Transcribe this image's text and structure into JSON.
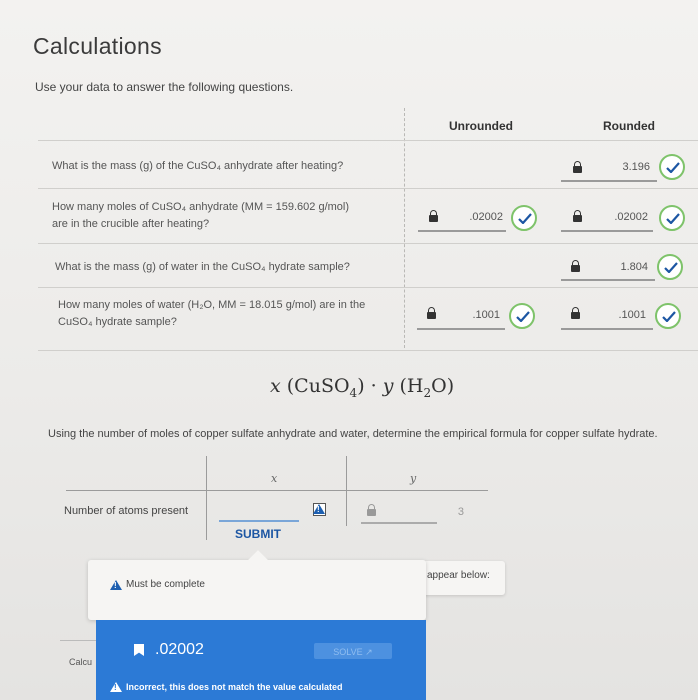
{
  "page": {
    "title": "Calculations",
    "subtitle": "Use your data to answer the following questions."
  },
  "table": {
    "headers": {
      "unrounded": "Unrounded",
      "rounded": "Rounded"
    },
    "rows": [
      {
        "question": "What is the mass (g) of the CuSO₄ anhydrate after heating?",
        "unrounded": "",
        "rounded": "3.196",
        "status": "correct"
      },
      {
        "question_line1": "How many moles of CuSO₄ anhydrate (MM = 159.602 g/mol)",
        "question_line2": "are in the crucible after heating?",
        "unrounded": ".02002",
        "rounded": ".02002",
        "status": "correct"
      },
      {
        "question": "What is the mass (g) of water in the CuSO₄ hydrate sample?",
        "unrounded": "",
        "rounded": "1.804",
        "status": "correct"
      },
      {
        "question_line1": "How many moles of water (H₂O, MM = 18.015 g/mol) are in the",
        "question_line2": "CuSO₄ hydrate sample?",
        "unrounded": ".1001",
        "rounded": ".1001",
        "status": "correct"
      }
    ]
  },
  "formula": {
    "x": "x",
    "p1": " (CuSO",
    "s1": "4",
    "p2": ")  · ",
    "y": "y",
    "p3": " (H",
    "s2": "2",
    "p4": "O)"
  },
  "instruction": "Using the number of moles of copper sulfate anhydrate and water, determine the empirical formula for copper sulfate hydrate.",
  "empirical_table": {
    "col_x": "x",
    "col_y": "y",
    "row_label": "Number of atoms present",
    "y_value": "3",
    "submit_label": "SUBMIT"
  },
  "popup": {
    "message": "Must be complete"
  },
  "hint": {
    "text": "appear below:"
  },
  "panel": {
    "value": ".02002",
    "solve_label": "SOLVE",
    "incorrect_text": "Incorrect, this does not match the value calculated"
  },
  "side": {
    "calc_label": "Calcu"
  },
  "colors": {
    "accent": "#2c7ad6",
    "check": "#7ec36a",
    "link": "#1c56a3"
  }
}
